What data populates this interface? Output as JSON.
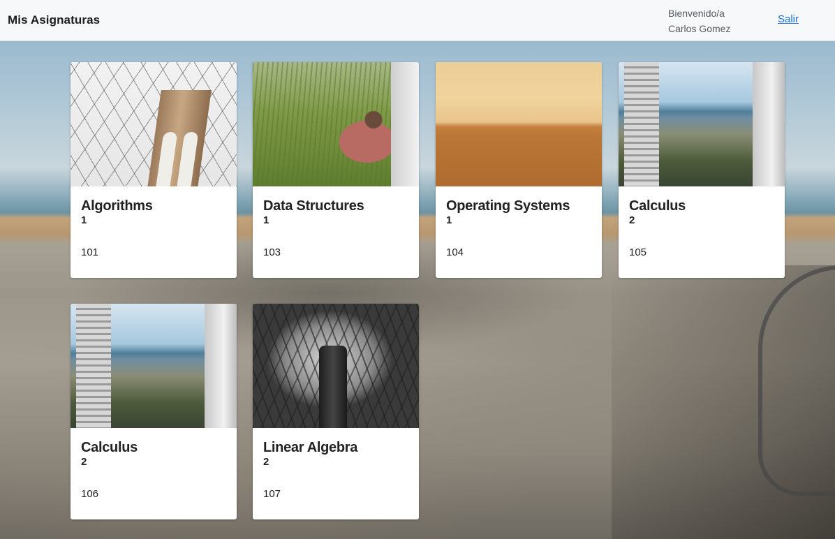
{
  "header": {
    "title": "Mis Asignaturas",
    "welcome_line1": "Bienvenido/a",
    "welcome_line2": "Carlos Gomez",
    "logout_label": "Salir"
  },
  "courses": [
    {
      "title": "Algorithms",
      "semester": "1",
      "code": "101",
      "image": "bridge-cables-photo"
    },
    {
      "title": "Data Structures",
      "semester": "1",
      "code": "103",
      "image": "person-in-grass-photo"
    },
    {
      "title": "Operating Systems",
      "semester": "1",
      "code": "104",
      "image": "desert-horizon-photo"
    },
    {
      "title": "Calculus",
      "semester": "2",
      "code": "105",
      "image": "coastal-buildings-photo"
    },
    {
      "title": "Calculus",
      "semester": "2",
      "code": "106",
      "image": "coastal-buildings-photo"
    },
    {
      "title": "Linear Algebra",
      "semester": "2",
      "code": "107",
      "image": "bare-trees-bw-photo"
    }
  ],
  "colors": {
    "header_bg": "#f7f8fa",
    "link": "#1a6fd6",
    "card_bg": "#ffffff",
    "text": "#222222"
  }
}
